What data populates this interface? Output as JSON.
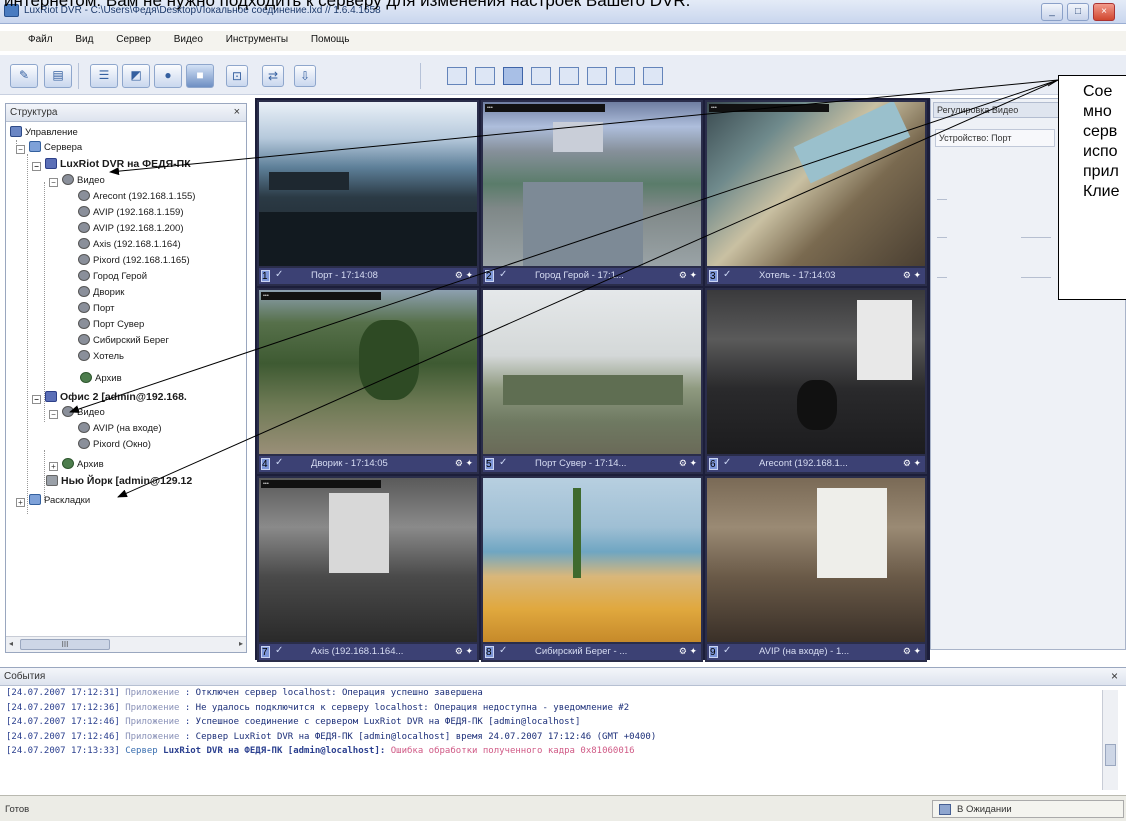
{
  "document": {
    "text_above": "интернетом. Вам не нужно подходить к серверу для изменения настроек Вашего DVR."
  },
  "window": {
    "title": "LuxRiot DVR - C:\\Users\\Федя\\Desktop\\Локальное соединение.lxd // 1.6.4.1658"
  },
  "menu": [
    "Файл",
    "Вид",
    "Сервер",
    "Видео",
    "Инструменты",
    "Помощь"
  ],
  "structure_panel": {
    "title": "Структура",
    "close": "×",
    "tree": [
      {
        "label": "Управление",
        "icon": "manager-icon",
        "bold": false
      },
      {
        "label": "Сервера",
        "icon": "servers-folder-icon",
        "bold": false
      },
      {
        "label": "LuxRiot DVR на ФЕДЯ-ПК",
        "icon": "server-icon",
        "bold": true
      },
      {
        "label": "Видео",
        "icon": "video-folder-icon",
        "bold": false
      },
      {
        "label": "Arecont (192.168.1.155)",
        "icon": "camera-icon",
        "bold": false
      },
      {
        "label": "AVIP (192.168.1.159)",
        "icon": "camera-icon",
        "bold": false
      },
      {
        "label": "AVIP (192.168.1.200)",
        "icon": "camera-icon",
        "bold": false
      },
      {
        "label": "Axis (192.168.1.164)",
        "icon": "camera-icon",
        "bold": false
      },
      {
        "label": "Pixord (192.168.1.165)",
        "icon": "camera-icon",
        "bold": false
      },
      {
        "label": "Город Герой",
        "icon": "camera-icon",
        "bold": false
      },
      {
        "label": "Дворик",
        "icon": "camera-icon",
        "bold": false
      },
      {
        "label": "Порт",
        "icon": "camera-icon",
        "bold": false
      },
      {
        "label": "Порт Сувер",
        "icon": "camera-icon",
        "bold": false
      },
      {
        "label": "Сибирский Берег",
        "icon": "camera-icon",
        "bold": false
      },
      {
        "label": "Хотель",
        "icon": "camera-icon",
        "bold": false
      },
      {
        "label": "Архив",
        "icon": "archive-icon",
        "bold": false
      },
      {
        "label": "Офис 2 [admin@192.168.",
        "icon": "server-icon",
        "bold": true
      },
      {
        "label": "Видео",
        "icon": "video-folder-icon",
        "bold": false
      },
      {
        "label": "AVIP (на входе)",
        "icon": "camera-icon",
        "bold": false
      },
      {
        "label": "Pixord (Окно)",
        "icon": "camera-icon",
        "bold": false
      },
      {
        "label": "Архив",
        "icon": "archive-icon",
        "bold": false
      },
      {
        "label": "Нью Йорк [admin@129.12",
        "icon": "server-icon",
        "bold": true
      },
      {
        "label": "Раскладки",
        "icon": "layouts-icon",
        "bold": false
      }
    ]
  },
  "video_cells": [
    {
      "label": "Порт - 17:14:08",
      "num": "1"
    },
    {
      "label": "Город Герой - 17:1...",
      "num": "2"
    },
    {
      "label": "Хотель - 17:14:03",
      "num": "3"
    },
    {
      "label": "Дворик - 17:14:05",
      "num": "4"
    },
    {
      "label": "Порт Сувер - 17:14...",
      "num": "5"
    },
    {
      "label": "Arecont (192.168.1...",
      "num": "6"
    },
    {
      "label": "Axis (192.168.1.164...",
      "num": "7"
    },
    {
      "label": "Сибирский Берег - ...",
      "num": "8"
    },
    {
      "label": "AVIP (на входе) - 1...",
      "num": "9"
    }
  ],
  "right_panel": {
    "tab": "Регулировка Видео",
    "sub": "Устройство: Порт"
  },
  "callout": {
    "lines": [
      "Сое",
      "мно",
      "серв",
      "испо",
      "прил",
      "Клие"
    ]
  },
  "events": {
    "title": "События",
    "close": "×",
    "rows": [
      {
        "time": "[24.07.2007 17:12:31]",
        "source": "Приложение",
        "source_kind": "app",
        "server": "",
        "msg": "Отключен сервер localhost: Операция успешно завершена",
        "error": false
      },
      {
        "time": "[24.07.2007 17:12:36]",
        "source": "Приложение",
        "source_kind": "app",
        "server": "",
        "msg": "Не удалось подключится к серверу localhost: Операция недоступна - уведомление #2",
        "error": false
      },
      {
        "time": "[24.07.2007 17:12:46]",
        "source": "Приложение",
        "source_kind": "app",
        "server": "",
        "msg": "Успешное соединение с сервером LuxRiot DVR на ФЕДЯ-ПК [admin@localhost]",
        "error": false
      },
      {
        "time": "[24.07.2007 17:12:46]",
        "source": "Приложение",
        "source_kind": "app",
        "server": "",
        "msg": "Сервер LuxRiot DVR на ФЕДЯ-ПК [admin@localhost] время 24.07.2007 17:12:46 (GMT +0400)",
        "error": false
      },
      {
        "time": "[24.07.2007 17:13:33]",
        "source": "Сервер",
        "source_kind": "server",
        "server": "LuxRiot DVR на ФЕДЯ-ПК [admin@localhost]:",
        "msg": "Ошибка обработки полученного кадра 0x81060016",
        "error": true
      }
    ]
  },
  "status": {
    "left": "Готов",
    "right": "В Ожидании"
  }
}
